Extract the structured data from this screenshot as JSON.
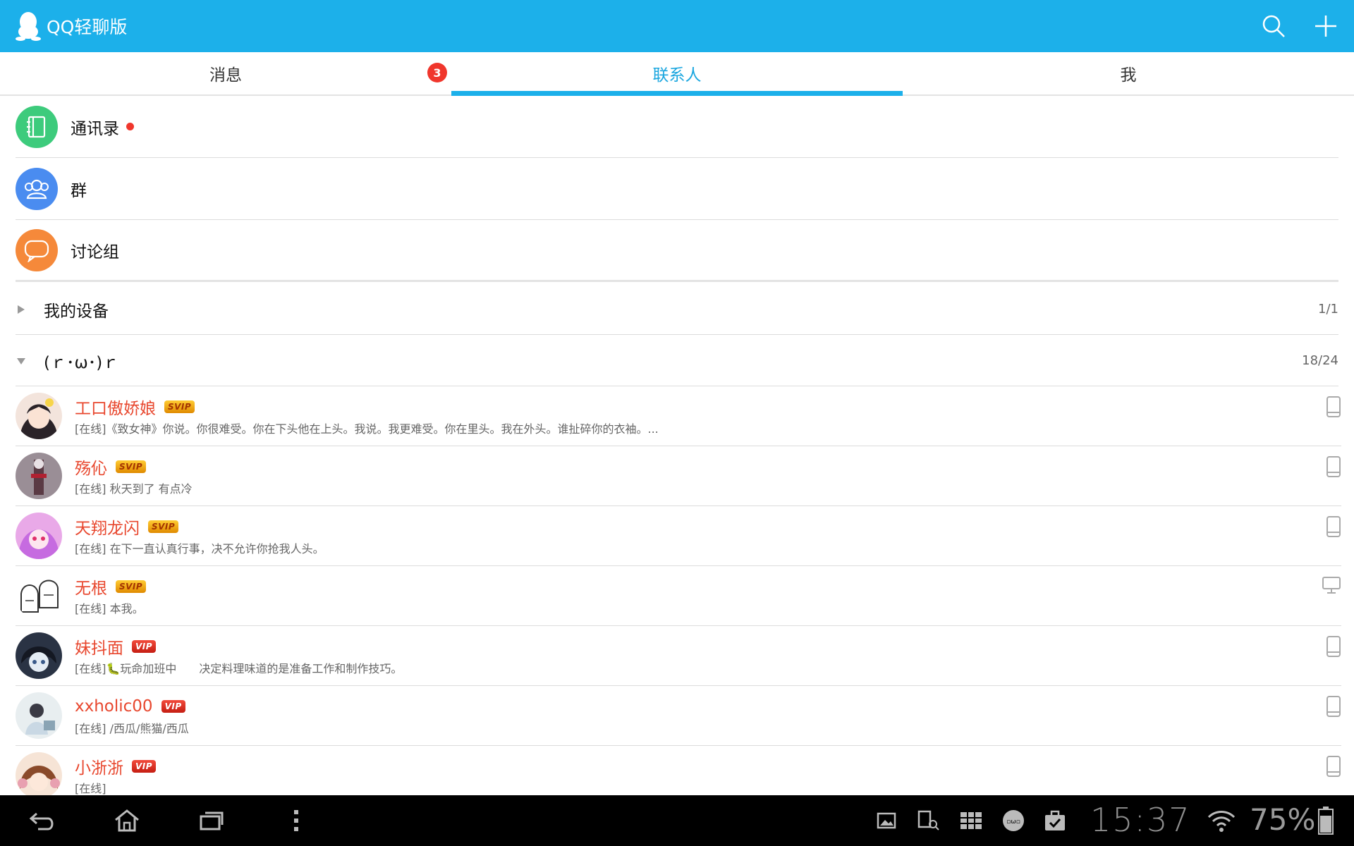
{
  "app": {
    "title": "QQ轻聊版"
  },
  "colors": {
    "accent": "#1cb0ea",
    "name_red": "#e8472e",
    "badge_red": "#f0362c"
  },
  "tabs": [
    {
      "label": "消息",
      "badge": "3",
      "active": false
    },
    {
      "label": "联系人",
      "active": true
    },
    {
      "label": "我",
      "active": false
    }
  ],
  "entries": [
    {
      "label": "通讯录",
      "icon": "address-book-icon",
      "color": "#3dcb7c",
      "has_dot": true
    },
    {
      "label": "群",
      "icon": "group-icon",
      "color": "#4a8cf0",
      "has_dot": false
    },
    {
      "label": "讨论组",
      "icon": "chat-bubble-icon",
      "color": "#f5893a",
      "has_dot": false
    }
  ],
  "groups": [
    {
      "name": "我的设备",
      "count": "1/1",
      "expanded": false
    },
    {
      "name": "(ｒ･ω･)ｒ",
      "count": "18/24",
      "expanded": true
    }
  ],
  "contacts": [
    {
      "name": "工口傲娇娘",
      "vip": "SVIP",
      "status": "[在线]《致女神》你说。你很难受。你在下头他在上头。我说。我更难受。你在里头。我在外头。谁扯碎你的衣袖。...",
      "device": "phone-icon"
    },
    {
      "name": "殇伈",
      "vip": "SVIP",
      "status": "[在线] 秋天到了 有点冷",
      "device": "phone-icon"
    },
    {
      "name": "天翔龙闪",
      "vip": "SVIP",
      "status": "[在线] 在下一直认真行事，决不允许你抢我人头。",
      "device": "phone-icon"
    },
    {
      "name": "无根",
      "vip": "SVIP",
      "status": "[在线] 本我。",
      "device": "desktop-icon"
    },
    {
      "name": "妹抖面",
      "vip": "VIP",
      "status": "[在线]🐛玩命加班中　　决定料理味道的是准备工作和制作技巧。",
      "device": "phone-icon"
    },
    {
      "name": "xxholic00",
      "vip": "VIP",
      "status": "[在线] /西瓜/熊猫/西瓜",
      "device": "phone-icon"
    },
    {
      "name": "小浙浙",
      "vip": "VIP",
      "status": "[在线]",
      "device": "phone-icon"
    }
  ],
  "system": {
    "clock": "15:37",
    "battery": "75%"
  }
}
